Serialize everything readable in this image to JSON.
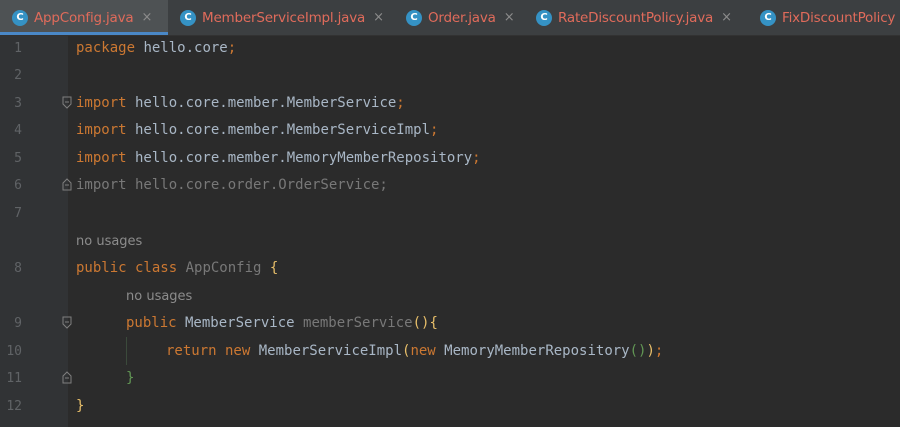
{
  "tabs": [
    {
      "label": "AppConfig.java",
      "icon": "class-icon",
      "active": true,
      "close": "×"
    },
    {
      "label": "MemberServiceImpl.java",
      "icon": "class-icon",
      "active": false,
      "close": "×"
    },
    {
      "label": "Order.java",
      "icon": "class-icon",
      "active": false,
      "close": "×"
    },
    {
      "label": "RateDiscountPolicy.java",
      "icon": "class-icon",
      "active": false,
      "close": "×"
    },
    {
      "label": "FixDiscountPolicy",
      "icon": "class-icon",
      "active": false,
      "close": ""
    }
  ],
  "tab_icon_letter": "C",
  "editor": {
    "line_numbers": [
      "1",
      "2",
      "3",
      "4",
      "5",
      "6",
      "7",
      "8",
      "9",
      "10",
      "11",
      "12"
    ],
    "hint_no_usages": "no usages",
    "lines": {
      "l1": {
        "kw": "package",
        "text": " hello.core",
        "semi": ";"
      },
      "l3": {
        "kw": "import",
        "text": " hello.core.member.MemberService",
        "semi": ";"
      },
      "l4": {
        "kw": "import",
        "text": " hello.core.member.MemberServiceImpl",
        "semi": ";"
      },
      "l5": {
        "kw": "import",
        "text": " hello.core.member.MemoryMemberRepository",
        "semi": ";"
      },
      "l6": {
        "text": "import hello.core.order.OrderService;"
      },
      "l8": {
        "kw": "public class",
        "name": " AppConfig",
        "brace": " {"
      },
      "l9": {
        "kw": "public",
        "type": " MemberService",
        "method": " memberService",
        "parens": "()",
        "brace": "{"
      },
      "l10": {
        "kw1": "return new",
        "t1": " MemberServiceImpl",
        "p1": "(",
        "kw2": "new",
        "t2": " MemoryMemberRepository",
        "p2": "()",
        "p3": ")",
        "semi": ";"
      },
      "l11": {
        "brace": "}"
      },
      "l12": {
        "brace": "}"
      }
    }
  },
  "colors": {
    "background": "#2b2b2b",
    "gutter": "#313335",
    "keyword": "#cc7832",
    "text": "#a9b7c6",
    "method": "#ffc66d",
    "unused": "#787878",
    "tab_label": "#e06b5b",
    "tab_icon": "#3592c4",
    "active_tab_underline": "#4a88c7"
  }
}
